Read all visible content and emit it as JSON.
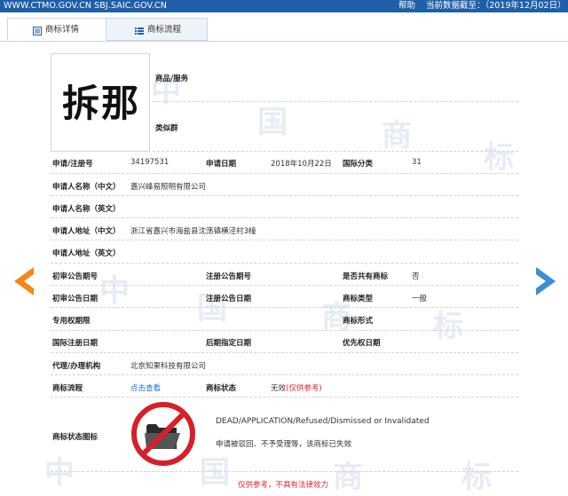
{
  "header": {
    "site": "WWW.CTMO.GOV.CN SBJ.SAIC.GOV.CN",
    "help": "帮助",
    "date": "当前数据截至：（2019年12月02日）"
  },
  "tabs": [
    {
      "label": "商标详情",
      "icon": "document-icon",
      "active": true
    },
    {
      "label": "商标流程",
      "icon": "list-icon",
      "active": false
    }
  ],
  "watermark": [
    "中",
    "国",
    "商",
    "标"
  ],
  "trademark": {
    "image_text": "拆那"
  },
  "fields": {
    "goods_label": "商品/服务",
    "group_label": "类似群",
    "reg_no_label": "申请/注册号",
    "reg_no": "34197531",
    "app_date_label": "申请日期",
    "app_date": "2018年10月22日",
    "intl_class_label": "国际分类",
    "intl_class": "31",
    "applicant_cn_label": "申请人名称（中文）",
    "applicant_cn": "嘉兴峰易照明有限公司",
    "applicant_en_label": "申请人名称（英文）",
    "address_cn_label": "申请人地址（中文）",
    "address_cn": "浙江省嘉兴市海盐县沈荡镇横泾村3幢",
    "address_en_label": "申请人地址（英文）",
    "prelim_no_label": "初审公告期号",
    "reg_pub_no_label": "注册公告期号",
    "shared_label": "是否共有商标",
    "shared": "否",
    "prelim_date_label": "初审公告日期",
    "reg_pub_date_label": "注册公告日期",
    "tm_type_label": "商标类型",
    "tm_type": "一般",
    "exclusive_label": "专用权期限",
    "tm_form_label": "商标形式",
    "intl_reg_date_label": "国际注册日期",
    "later_date_label": "后期指定日期",
    "priority_date_label": "优先权日期",
    "agent_label": "代理/办理机构",
    "agent": "北京知果科技有限公司",
    "flow_label": "商标流程",
    "flow_link": "点击查看",
    "status_label": "商标状态",
    "status": "无效",
    "status_note": "(仅供参考)",
    "status_icon_label": "商标状态图标",
    "status_en": "DEAD/APPLICATION/Refused/Dismissed or Invalidated",
    "status_cn": "申请被驳回、不予受理等，该商标已失效"
  },
  "footer": "仅供参考，不具有法律效力",
  "colors": {
    "header_bg": "#1f5fa8",
    "arrow_left": "#f08a16",
    "arrow_right": "#3a8fd6",
    "warning": "#e4232b",
    "link": "#1e6ed2"
  },
  "nav": {
    "prev_icon": "arrow-left-icon",
    "next_icon": "arrow-right-icon"
  }
}
